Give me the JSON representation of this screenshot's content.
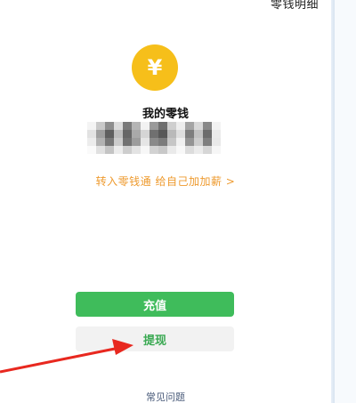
{
  "header": {
    "detail_link": "零钱明细"
  },
  "coin_icon": {
    "glyph": "¥",
    "color": "#f6bf1a"
  },
  "wallet": {
    "title": "我的零钱",
    "transfer_link": "转入零钱通 给自己加加薪 >"
  },
  "actions": {
    "recharge_label": "充值",
    "withdraw_label": "提现"
  },
  "footer": {
    "faq_link": "常见问题"
  },
  "colors": {
    "primary_green": "#3fbc5b",
    "accent_orange": "#ee9a2e",
    "annotation_red": "#e8281f"
  }
}
